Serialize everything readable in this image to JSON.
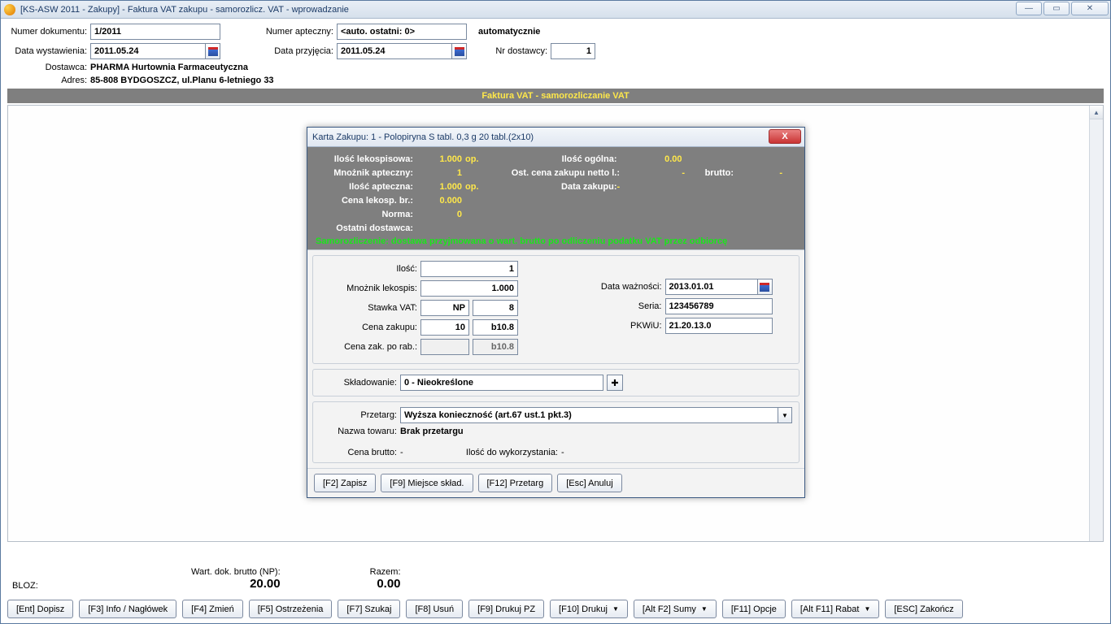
{
  "window": {
    "title": "[KS-ASW 2011 - Zakupy] - Faktura VAT zakupu - samorozlicz. VAT - wprowadzanie"
  },
  "header": {
    "doc_no_label": "Numer dokumentu:",
    "doc_no": "1/2011",
    "pharmacy_no_label": "Numer apteczny:",
    "pharmacy_no": "<auto. ostatni: 0>",
    "auto_text": "automatycznie",
    "issue_date_label": "Data wystawienia:",
    "issue_date": "2011.05.24",
    "recv_date_label": "Data przyjęcia:",
    "recv_date": "2011.05.24",
    "supplier_no_label": "Nr dostawcy:",
    "supplier_no": "1",
    "supplier_label": "Dostawca:",
    "supplier": "PHARMA Hurtownia Farmaceutyczna",
    "address_label": "Adres:",
    "address": "85-808 BYDGOSZCZ, ul.Planu 6-letniego 33",
    "banner": "Faktura VAT - samorozliczanie VAT"
  },
  "footer": {
    "bloz_label": "BLOZ:",
    "wart_label": "Wart. dok. brutto (NP):",
    "wart_value": "20.00",
    "razem_label": "Razem:",
    "razem_value": "0.00"
  },
  "buttons": [
    "[Ent] Dopisz",
    "[F3] Info / Nagłówek",
    "[F4] Zmień",
    "[F5] Ostrzeżenia",
    "[F7] Szukaj",
    "[F8] Usuń",
    "[F9] Drukuj PZ",
    "[F10] Drukuj",
    "[Alt F2] Sumy",
    "[F11] Opcje",
    "[Alt F11] Rabat",
    "[ESC] Zakończ"
  ],
  "dialog": {
    "title": "Karta Zakupu: 1 - Polopiryna S tabl. 0,3 g 20 tabl.(2x10)",
    "info": {
      "l_ilosc_lekospisowa": "Ilość lekospisowa:",
      "v_ilosc_lekospisowa": "1.000",
      "u_op": "op.",
      "l_mnoznik_apteczny": "Mnożnik apteczny:",
      "v_mnoznik_apteczny": "1",
      "l_ilosc_apteczna": "Ilość apteczna:",
      "v_ilosc_apteczna": "1.000",
      "l_cena_lekosp": "Cena lekosp. br.:",
      "v_cena_lekosp": "0.000",
      "l_norma": "Norma:",
      "v_norma": "0",
      "l_ostatni_dostawca": "Ostatni dostawca:",
      "l_ilosc_ogolna": "Ilość ogólna:",
      "v_ilosc_ogolna": "0.00",
      "l_ost_cena_netto": "Ost. cena zakupu netto l.:",
      "v_ost_cena_netto": "-",
      "l_brutto": "brutto:",
      "v_brutto": "-",
      "l_data_zakupu": "Data zakupu:",
      "v_data_zakupu": "-",
      "green_note": "Samorozliczenie: dostawa przyjmowana o wart. brutto po odliczeniu podatku VAT przez odbiorcę"
    },
    "form": {
      "l_ilosc": "Ilość:",
      "v_ilosc": "1",
      "l_mnoznik": "Mnożnik lekospis:",
      "v_mnoznik": "1.000",
      "l_vat": "Stawka VAT:",
      "v_vat_code": "NP",
      "v_vat_rate": "8",
      "l_cena_zakupu": "Cena zakupu:",
      "v_cena_zakupu": "10",
      "v_cena_zakupu_b": "b10.8",
      "l_cena_po_rab": "Cena zak. po rab.:",
      "v_cena_po_rab": "b10.8",
      "l_data_wazn": "Data ważności:",
      "v_data_wazn": "2013.01.01",
      "l_seria": "Seria:",
      "v_seria": "123456789",
      "l_pkwiu": "PKWiU:",
      "v_pkwiu": "21.20.13.0",
      "l_sklad": "Składowanie:",
      "v_sklad": "0 - Nieokreślone",
      "l_przetarg": "Przetarg:",
      "v_przetarg": "Wyższa konieczność (art.67 ust.1 pkt.3)",
      "l_nazwa_tow": "Nazwa towaru:",
      "v_nazwa_tow": "Brak przetargu",
      "l_cena_brutto": "Cena brutto:",
      "v_cena_brutto": "-",
      "l_ilosc_wyk": "Ilość do wykorzystania:",
      "v_ilosc_wyk": "-"
    },
    "buttons": {
      "save": "[F2] Zapisz",
      "place": "[F9] Miejsce skład.",
      "tender": "[F12] Przetarg",
      "cancel": "[Esc] Anuluj"
    }
  }
}
